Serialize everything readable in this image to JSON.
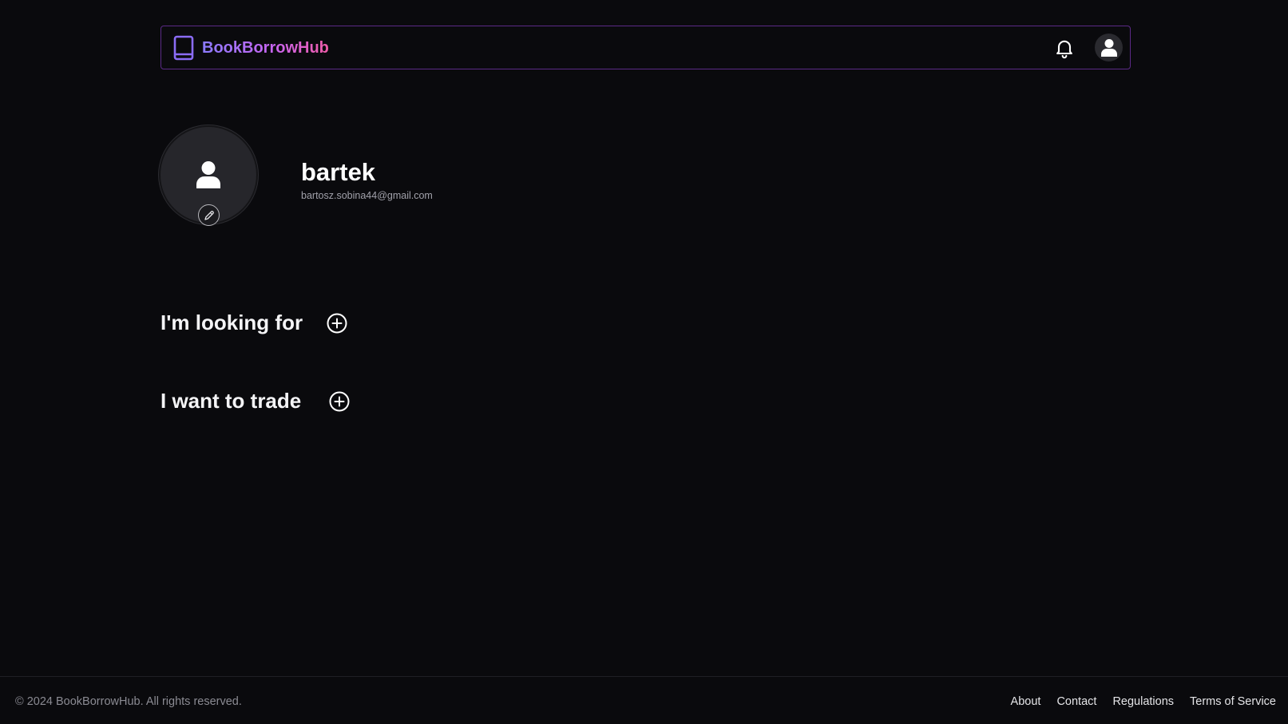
{
  "header": {
    "brand": "BookBorrowHub",
    "brand_icon": "book-icon",
    "notifications_icon": "bell-icon",
    "account_icon": "user-avatar-icon"
  },
  "profile": {
    "username": "bartek",
    "email": "bartosz.sobina44@gmail.com",
    "avatar_icon": "user-icon",
    "edit_icon": "pencil-icon"
  },
  "sections": {
    "looking_for": {
      "title": "I'm looking for",
      "add_icon": "plus-circle-icon"
    },
    "want_to_trade": {
      "title": "I want to trade",
      "add_icon": "plus-circle-icon"
    }
  },
  "footer": {
    "copyright": "© 2024 BookBorrowHub. All rights reserved.",
    "links": [
      "About",
      "Contact",
      "Regulations",
      "Terms of Service"
    ]
  },
  "colors": {
    "background": "#0a0a0d",
    "navbar_border": "#5b2a86",
    "brand_gradient_start": "#8b7bff",
    "brand_gradient_end": "#f05ca8",
    "icon_purple": "#8b6cf6"
  }
}
